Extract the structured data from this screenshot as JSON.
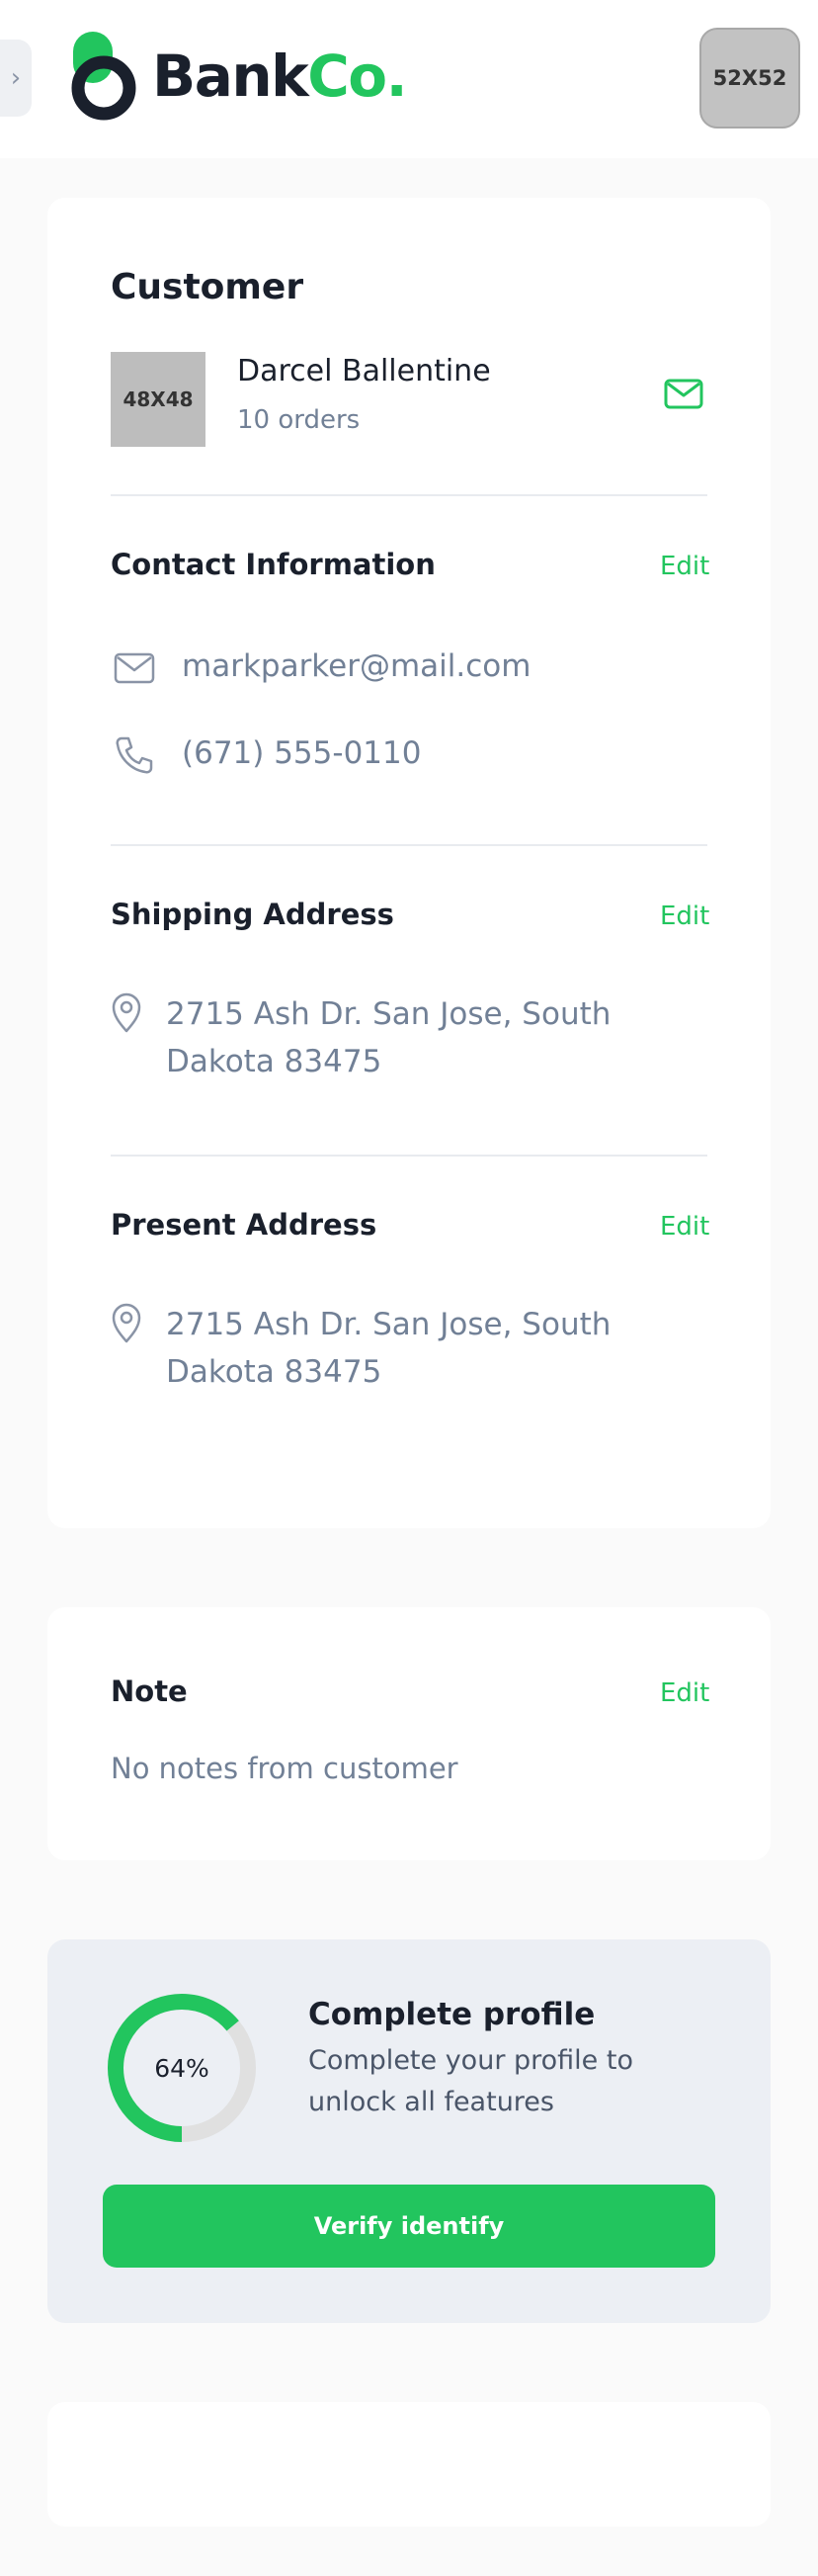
{
  "header": {
    "brand_part1": "Bank",
    "brand_part2": "Co.",
    "toggle_glyph": "›",
    "avatar_placeholder": "52X52",
    "brand_color": "#22c55e"
  },
  "customer": {
    "title": "Customer",
    "avatar_placeholder": "48X48",
    "name": "Darcel Ballentine",
    "orders": "10 orders",
    "mail_icon": "mail-icon"
  },
  "contact": {
    "title": "Contact Information",
    "edit_label": "Edit",
    "email": "markparker@mail.com",
    "phone": "(671) 555-0110"
  },
  "shipping": {
    "title": "Shipping Address",
    "edit_label": "Edit",
    "address": "2715 Ash Dr. San Jose, South Dakota 83475"
  },
  "present": {
    "title": "Present Address",
    "edit_label": "Edit",
    "address": "2715 Ash Dr. San Jose, South Dakota 83475"
  },
  "note": {
    "title": "Note",
    "edit_label": "Edit",
    "text": "No notes from customer"
  },
  "profile": {
    "progress_percent": 64,
    "progress_label": "64%",
    "title": "Complete profile",
    "description": "Complete your profile to unlock all features",
    "button_label": "Verify identify"
  }
}
